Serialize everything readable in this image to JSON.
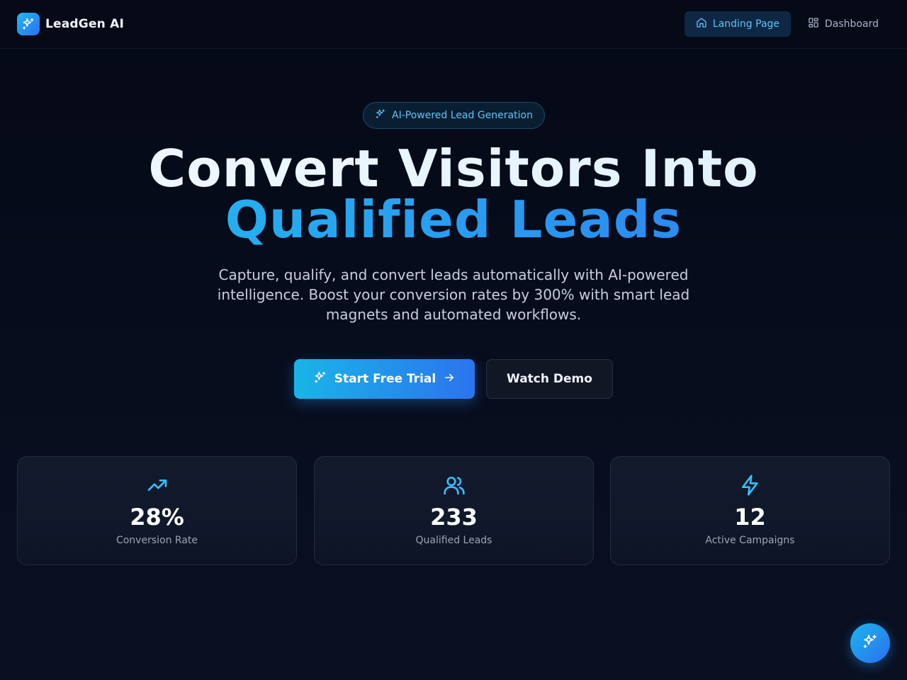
{
  "brand": {
    "name": "LeadGen AI",
    "icon": "sparkles-icon"
  },
  "nav": {
    "items": [
      {
        "label": "Landing Page",
        "icon": "home-icon",
        "active": true
      },
      {
        "label": "Dashboard",
        "icon": "grid-icon",
        "active": false
      }
    ]
  },
  "hero": {
    "badge": "AI-Powered Lead Generation",
    "title_line1": "Convert Visitors Into",
    "title_line2": "Qualified Leads",
    "subtitle": "Capture, qualify, and convert leads automatically with AI-powered intelligence. Boost your conversion rates by 300% with smart lead magnets and automated workflows.",
    "primary_cta": "Start Free Trial",
    "secondary_cta": "Watch Demo"
  },
  "stats": [
    {
      "value": "28%",
      "label": "Conversion Rate",
      "icon": "trending-up-icon"
    },
    {
      "value": "233",
      "label": "Qualified Leads",
      "icon": "users-icon"
    },
    {
      "value": "12",
      "label": "Active Campaigns",
      "icon": "lightning-icon"
    }
  ],
  "colors": {
    "accent": "#22b8ef",
    "accent_end": "#2b6ff0",
    "background": "#070c1c",
    "card": "#121a2c"
  }
}
